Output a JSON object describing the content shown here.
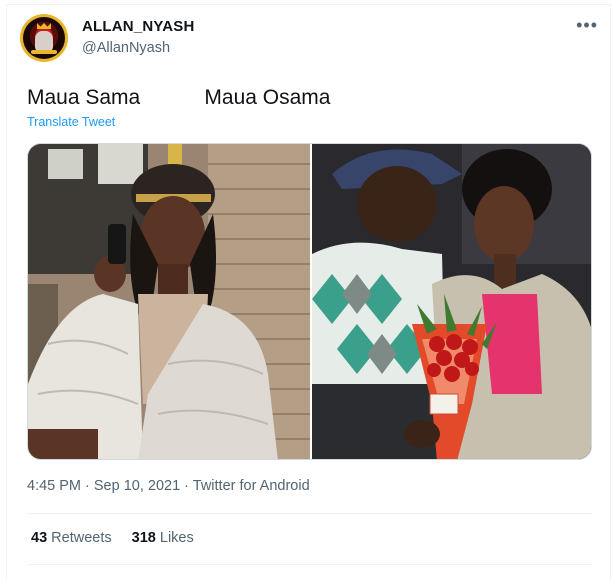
{
  "author": {
    "name": "ALLAN_NYASH",
    "handle": "@AllanNyash"
  },
  "tweet": {
    "text": "Maua Sama           Maua Osama",
    "translate_label": "Translate Tweet",
    "timestamp": "4:45 PM · Sep 10, 2021 · Twitter for Android"
  },
  "media": [
    {
      "label": "Woman in silver puffer jacket and beaded headscarf holding phone"
    },
    {
      "label": "Man in cap kissing smiling woman holding red roses bouquet"
    }
  ],
  "stats": {
    "retweets_count": "43",
    "retweets_label": "Retweets",
    "likes_count": "318",
    "likes_label": "Likes"
  },
  "colors": {
    "link": "#1d9bf0",
    "secondary_text": "#536471",
    "avatar_ring": "#e8b62a"
  },
  "icons": {
    "more": "more-horizontal-icon"
  }
}
